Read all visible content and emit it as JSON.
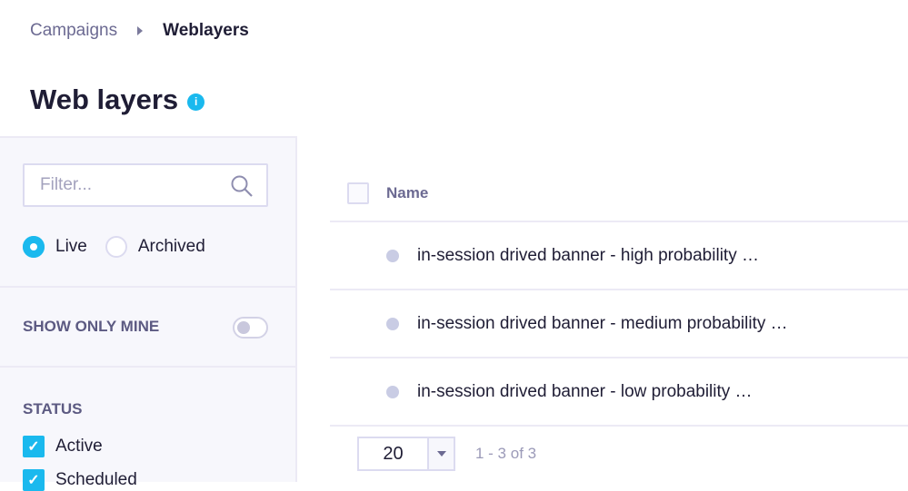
{
  "breadcrumb": {
    "parent": "Campaigns",
    "current": "Weblayers"
  },
  "page": {
    "title": "Web layers",
    "info_icon": "info-icon"
  },
  "sidebar": {
    "filter_placeholder": "Filter...",
    "radios": [
      {
        "label": "Live",
        "selected": true
      },
      {
        "label": "Archived",
        "selected": false
      }
    ],
    "show_only_mine": {
      "label": "SHOW ONLY MINE",
      "on": false
    },
    "status": {
      "title": "STATUS",
      "items": [
        {
          "label": "Active",
          "checked": true
        },
        {
          "label": "Scheduled",
          "checked": true
        }
      ]
    }
  },
  "table": {
    "header": "Name",
    "rows": [
      {
        "name": "in-session drived banner - high probability …"
      },
      {
        "name": "in-session drived banner - medium probability …"
      },
      {
        "name": "in-session drived banner - low probability …"
      }
    ]
  },
  "pagination": {
    "page_size": "20",
    "range": "1 - 3 of 3"
  },
  "colors": {
    "accent": "#1ab9ee"
  }
}
